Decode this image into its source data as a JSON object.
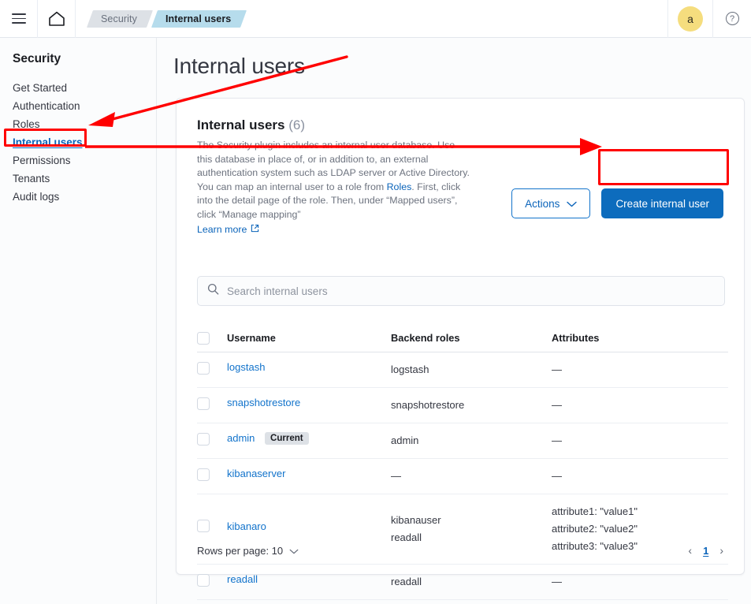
{
  "topbar": {
    "menu_icon": "hamburger-menu-icon",
    "home_icon": "home-icon",
    "breadcrumbs": [
      {
        "label": "Security",
        "active": false
      },
      {
        "label": "Internal users",
        "active": true
      }
    ],
    "avatar_initial": "a",
    "help_label": "?"
  },
  "sidebar": {
    "title": "Security",
    "items": [
      {
        "label": "Get Started"
      },
      {
        "label": "Authentication"
      },
      {
        "label": "Roles"
      },
      {
        "label": "Internal users"
      },
      {
        "label": "Permissions"
      },
      {
        "label": "Tenants"
      },
      {
        "label": "Audit logs"
      }
    ]
  },
  "main": {
    "page_title": "Internal users",
    "panel_title": "Internal users",
    "panel_count": "(6)",
    "description_part1": "The Security plugin includes an internal user database. Use this database in place of, or in addition to, an external authentication system such as LDAP server or Active Directory. You can map an internal user to a role from ",
    "description_link": "Roles",
    "description_part2": ". First, click into the detail page of the role. Then, under “Mapped users”, click “Manage mapping”",
    "learn_more": "Learn more",
    "actions_button": "Actions",
    "create_button": "Create internal user",
    "search_placeholder": "Search internal users"
  },
  "table": {
    "columns": [
      "Username",
      "Backend roles",
      "Attributes"
    ],
    "rows": [
      {
        "username": "logstash",
        "badge": "",
        "backend_roles": "logstash",
        "attributes": "—"
      },
      {
        "username": "snapshotrestore",
        "badge": "",
        "backend_roles": "snapshotrestore",
        "attributes": "—"
      },
      {
        "username": "admin",
        "badge": "Current",
        "backend_roles": "admin",
        "attributes": "—"
      },
      {
        "username": "kibanaserver",
        "badge": "",
        "backend_roles": "—",
        "attributes": "—"
      },
      {
        "username": "kibanaro",
        "badge": "",
        "backend_roles": "kibanauser\nreadall",
        "attributes": "attribute1: \"value1\"\nattribute2: \"value2\"\nattribute3: \"value3\""
      },
      {
        "username": "readall",
        "badge": "",
        "backend_roles": "readall",
        "attributes": "—"
      }
    ]
  },
  "footer": {
    "rows_per_page_label": "Rows per page: 10",
    "prev_arrow": "‹",
    "page_number": "1",
    "next_arrow": "›"
  },
  "colors": {
    "accent_blue": "#0d6cbd",
    "link_blue": "#1273cb",
    "annotation_red": "#ff0000",
    "avatar_yellow": "#f5dd7e",
    "breadcrumb_active": "#b6dcec"
  }
}
